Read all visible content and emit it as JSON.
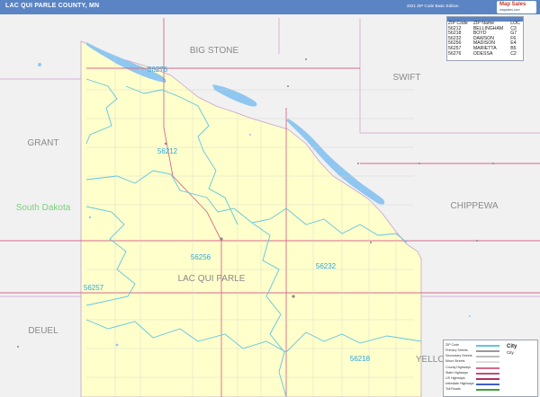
{
  "header": {
    "title": "LAC QUI PARLE COUNTY, MN",
    "edition": "2021 ZIP Code Basic Edition",
    "logo_line1": "Map Sales",
    "logo_line2": "mapsales.com"
  },
  "map": {
    "neighbor_labels": [
      {
        "id": "big-stone",
        "text": "BIG STONE"
      },
      {
        "id": "swift",
        "text": "SWIFT"
      },
      {
        "id": "grant",
        "text": "GRANT"
      },
      {
        "id": "chippewa",
        "text": "CHIPPEWA"
      },
      {
        "id": "deuel",
        "text": "DEUEL"
      },
      {
        "id": "yellow",
        "text": "YELLO"
      },
      {
        "id": "lac-qui-parle",
        "text": "LAC QUI PARLE"
      }
    ],
    "state_label": "South Dakota",
    "zip_labels": [
      "56276",
      "56212",
      "56256",
      "56232",
      "56257",
      "56218"
    ],
    "colors": {
      "county_fill": "#ffffcc",
      "background": "#f1f1f1",
      "water": "#8fc7f0",
      "zip_boundary": "#5fc6e0",
      "zip_label": "#2aa7e0",
      "highway": "#d46a8a",
      "state_label": "#7cd07c"
    }
  },
  "legend": {
    "headers": [
      "ZIP Code",
      "ZIP Name",
      "LOC"
    ],
    "rows": [
      [
        "56212",
        "BELLINGHAM",
        "C3"
      ],
      [
        "56218",
        "BOYD",
        "G7"
      ],
      [
        "56232",
        "DAWSON",
        "F6"
      ],
      [
        "56256",
        "MADISON",
        "E4"
      ],
      [
        "56257",
        "MARIETTA",
        "B5"
      ],
      [
        "56276",
        "ODESSA",
        "C2"
      ]
    ]
  },
  "key": {
    "items": [
      "ZIP Code",
      "Primary Streets",
      "Secondary Streets",
      "Minor Streets",
      "County Highways",
      "State Highways",
      "US Highways",
      "Interstate Highways",
      "Toll Roads"
    ],
    "city_large": "City",
    "city_small": "City"
  }
}
